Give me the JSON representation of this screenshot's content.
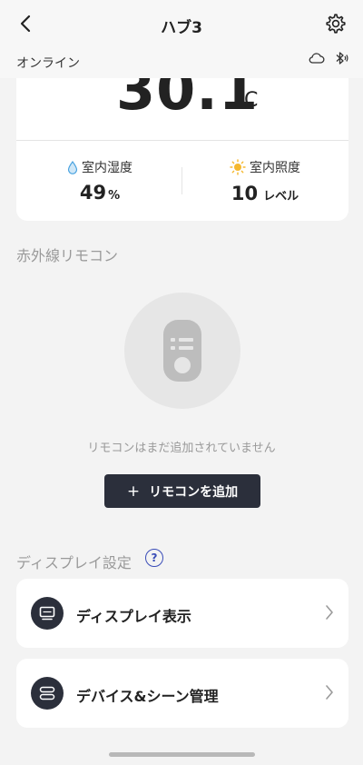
{
  "header": {
    "title": "ハブ3",
    "status": "オンライン"
  },
  "climate": {
    "temperature": "30.1",
    "temperature_unit": "°C",
    "humidity": {
      "label": "室内湿度",
      "value": "49",
      "unit": "%"
    },
    "illuminance": {
      "label": "室内照度",
      "value": "10",
      "unit": "レベル"
    }
  },
  "ir_remote": {
    "section_title": "赤外線リモコン",
    "empty_message": "リモコンはまだ追加されていません",
    "add_button_label": "リモコンを追加"
  },
  "display_settings": {
    "section_title": "ディスプレイ設定",
    "help_glyph": "?",
    "items": [
      {
        "label": "ディスプレイ表示",
        "icon": "monitor-icon"
      },
      {
        "label": "デバイス&シーン管理",
        "icon": "toggle-list-icon"
      }
    ]
  },
  "colors": {
    "accent": "#3a4db8",
    "dark": "#2b2f3b",
    "humidity_icon": "#4aa3e0",
    "sun_icon": "#f5b82e"
  }
}
